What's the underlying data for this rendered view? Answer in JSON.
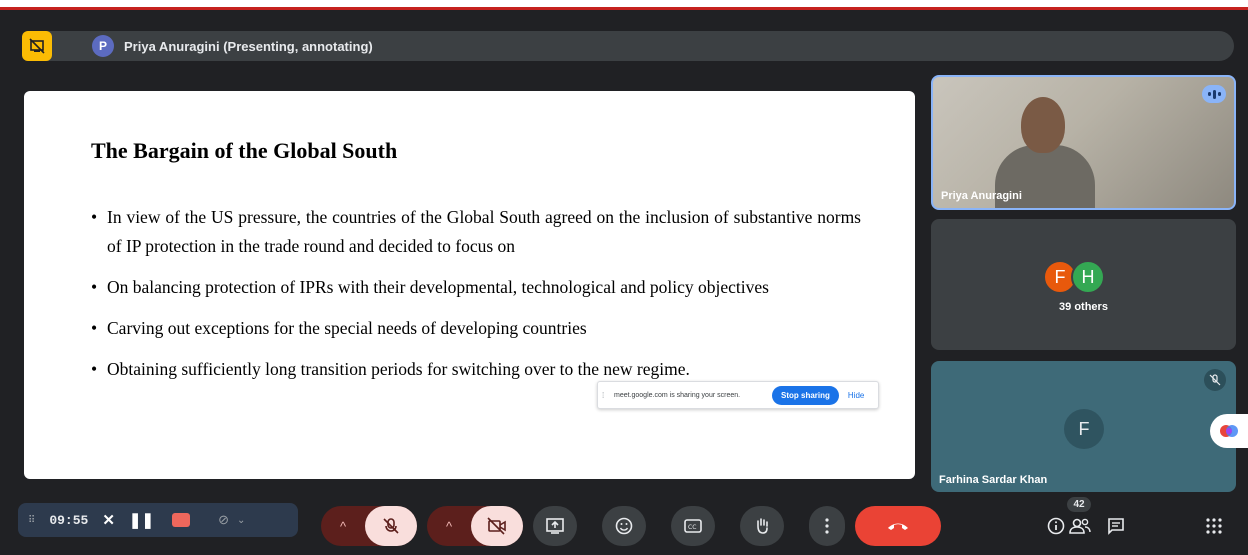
{
  "banner": {
    "avatar_letter": "P",
    "text": "Priya Anuragini (Presenting, annotating)"
  },
  "slide": {
    "title": "The Bargain of the Global South",
    "bullets": [
      "In view of the US pressure, the countries of the Global South agreed on the inclusion of substantive norms of IP protection in the trade round and decided to focus on",
      "On  balancing protection of IPRs with their developmental, technological and policy objectives",
      "Carving  out exceptions for the special needs of developing countries",
      "Obtaining sufficiently long transition periods for switching over to the new regime."
    ]
  },
  "share_bar": {
    "text": "meet.google.com is sharing your screen.",
    "stop_label": "Stop sharing",
    "hide_label": "Hide"
  },
  "tiles": {
    "presenter_name": "Priya Anuragini",
    "others": {
      "avatar1": "F",
      "avatar2": "H",
      "label": "39 others"
    },
    "farhina": {
      "avatar": "F",
      "name": "Farhina Sardar Khan"
    }
  },
  "recording": {
    "time": "09:55"
  },
  "people_count": "42",
  "colors": {
    "accent": "#fbbc04",
    "leave": "#ea4335",
    "speaking": "#8ab4f8"
  }
}
